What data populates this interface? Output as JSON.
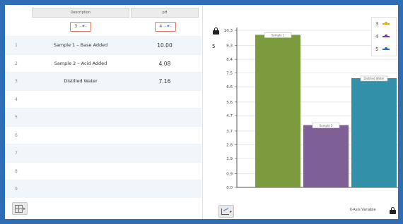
{
  "table": {
    "columns": [
      {
        "header": "Description",
        "selected_sensor": "3"
      },
      {
        "header": "pH",
        "selected_sensor": "4"
      }
    ],
    "rows": [
      {
        "index": "1",
        "description": "Sample 1 – Base Added",
        "ph": "10.00"
      },
      {
        "index": "2",
        "description": "Sample 2 – Acid Added",
        "ph": "4.08"
      },
      {
        "index": "3",
        "description": "Distilled Water",
        "ph": "7.16"
      },
      {
        "index": "4",
        "description": "",
        "ph": ""
      },
      {
        "index": "5",
        "description": "",
        "ph": ""
      },
      {
        "index": "6",
        "description": "",
        "ph": ""
      },
      {
        "index": "7",
        "description": "",
        "ph": ""
      },
      {
        "index": "8",
        "description": "",
        "ph": ""
      },
      {
        "index": "9",
        "description": "",
        "ph": ""
      }
    ]
  },
  "chart": {
    "y_selector": "5",
    "x_axis_button": "X-Axis Variable",
    "legend": [
      {
        "label": "3",
        "color": "#e0b000"
      },
      {
        "label": "4",
        "color": "#7b3aa8"
      },
      {
        "label": "5",
        "color": "#2f6db5"
      }
    ]
  },
  "chart_data": {
    "type": "bar",
    "categories": [
      "Sample 1",
      "Sample 2",
      "Distilled Water"
    ],
    "values": [
      10.0,
      4.08,
      7.16
    ],
    "colors": [
      "#7c9a3e",
      "#7e5f96",
      "#3290a9"
    ],
    "ylim": [
      0,
      10.3
    ],
    "yticks": [
      "0.0",
      "0.9",
      "1.9",
      "2.8",
      "3.7",
      "4.7",
      "5.6",
      "6.6",
      "7.5",
      "8.4",
      "9.3",
      "10.3"
    ],
    "grid": true
  }
}
